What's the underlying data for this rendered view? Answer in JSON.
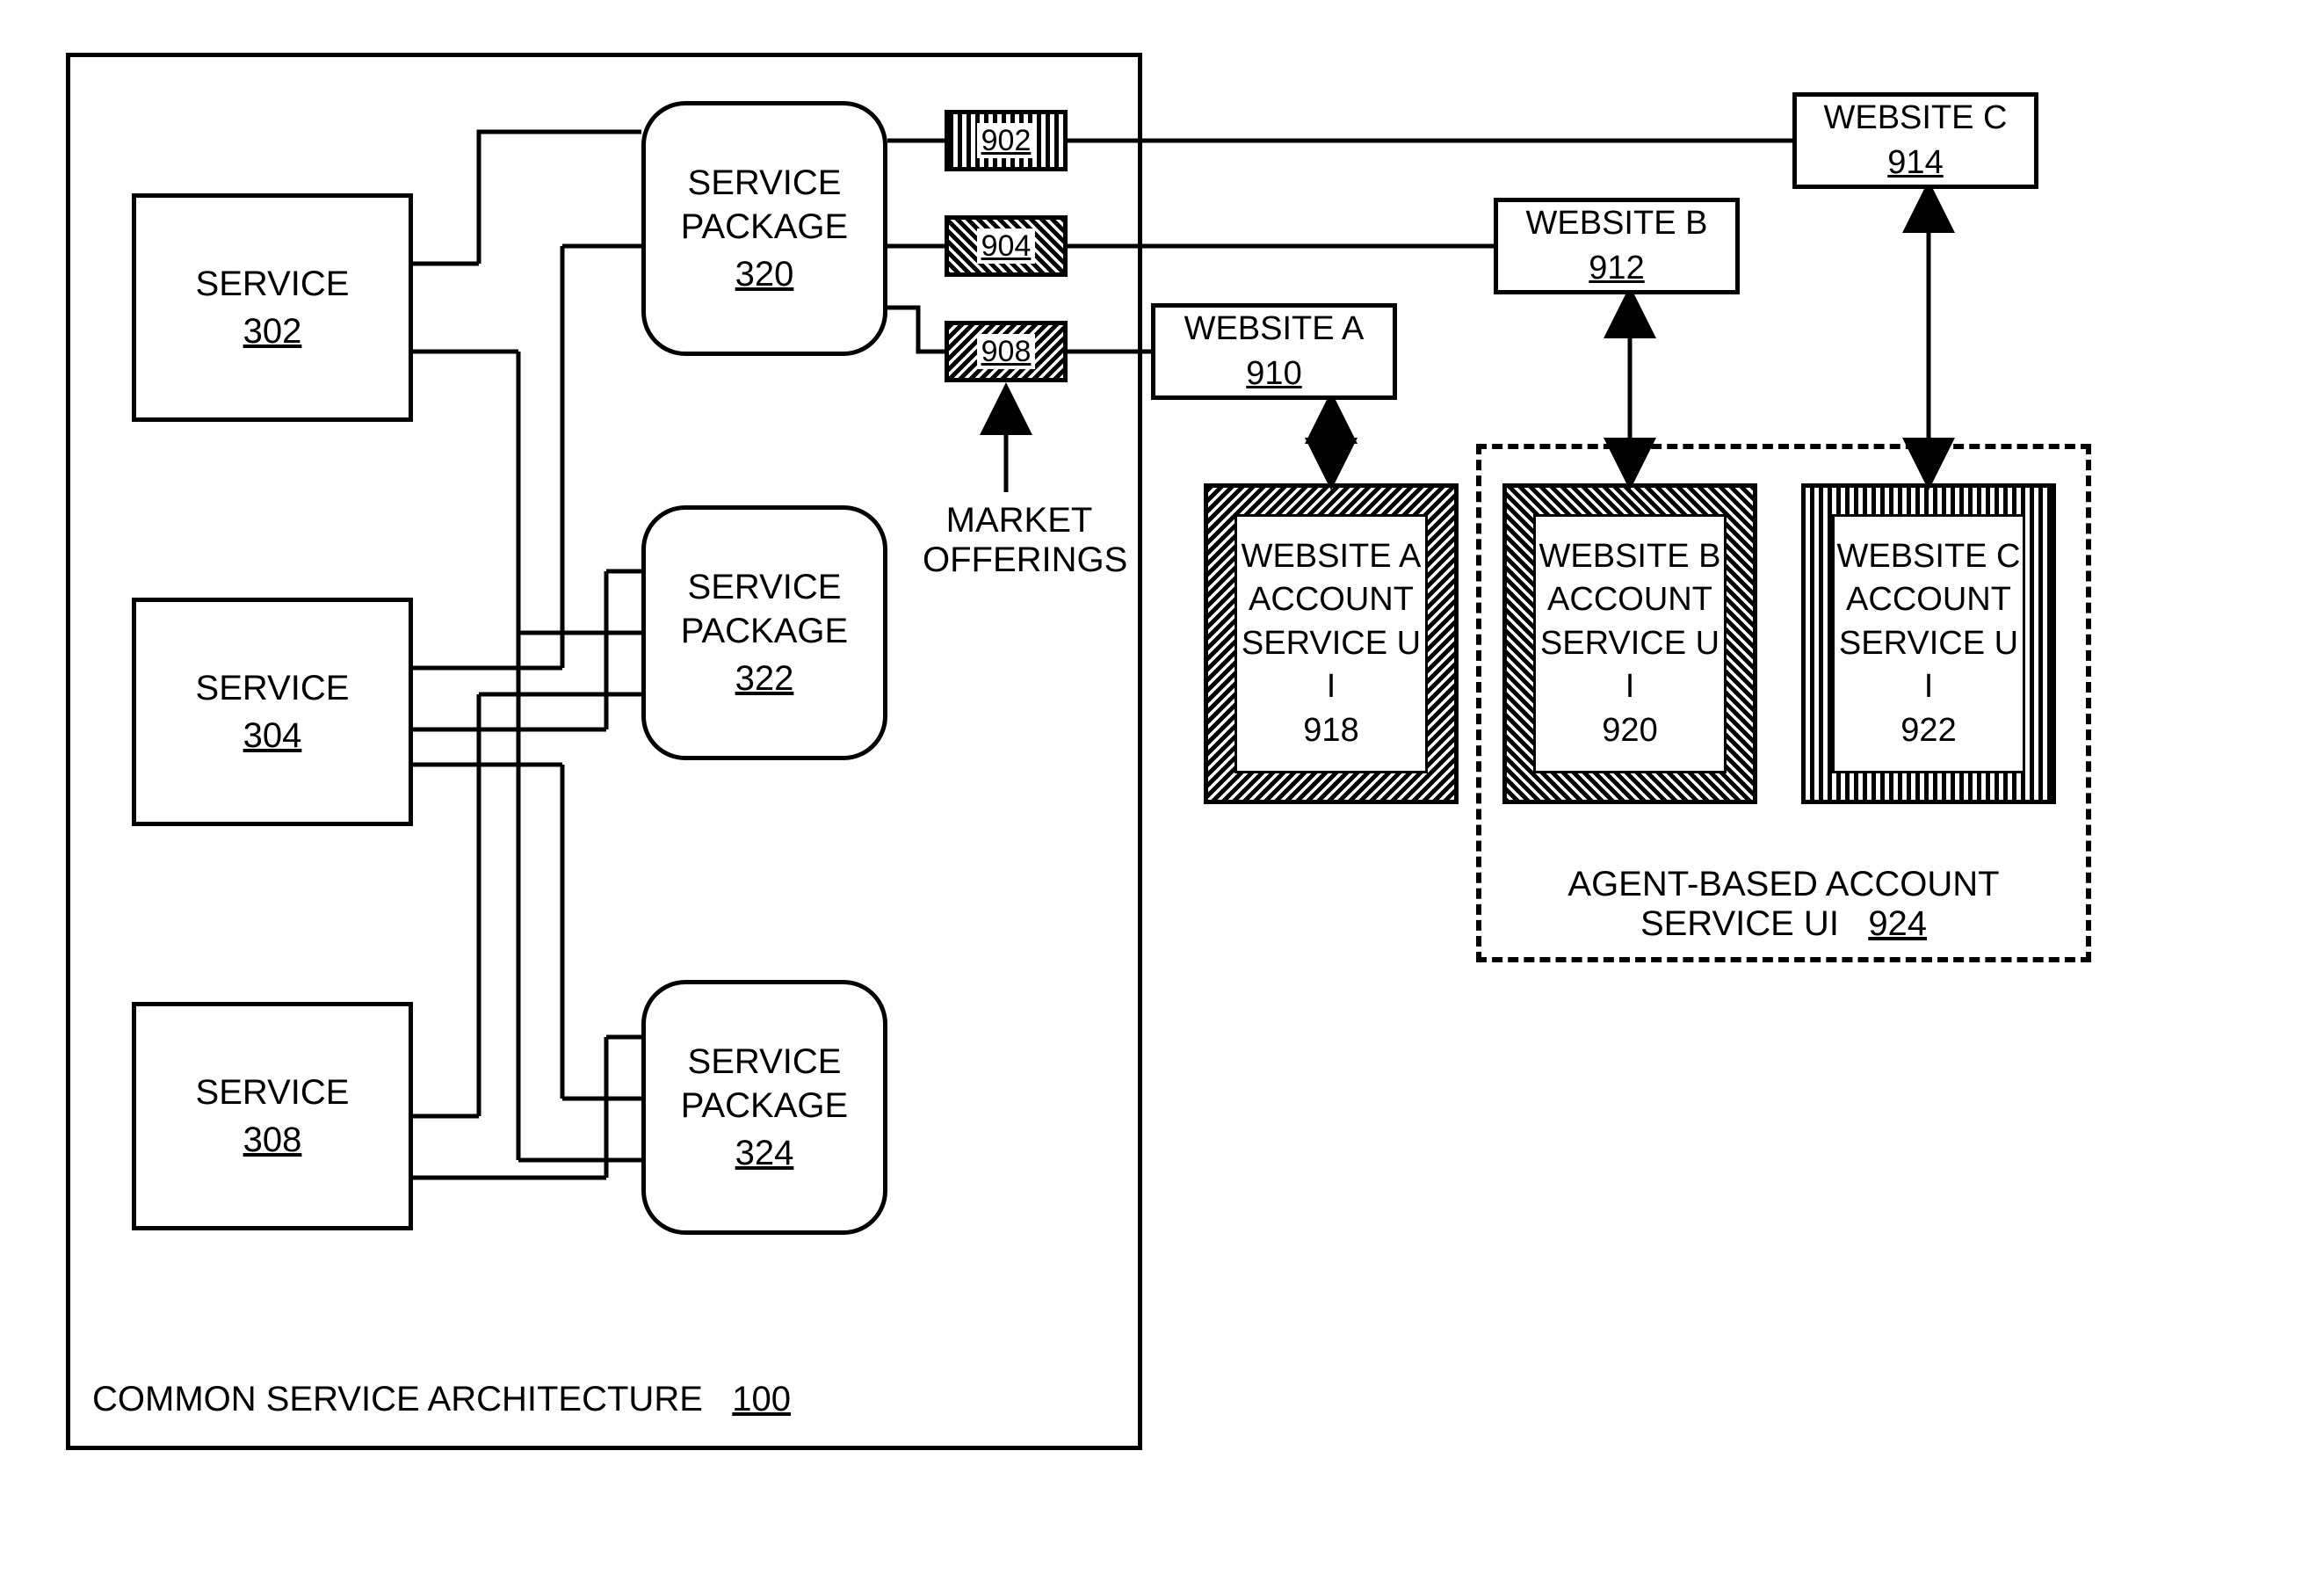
{
  "architecture": {
    "label": "COMMON SERVICE ARCHITECTURE",
    "ref": "100"
  },
  "services": [
    {
      "label": "SERVICE",
      "ref": "302"
    },
    {
      "label": "SERVICE",
      "ref": "304"
    },
    {
      "label": "SERVICE",
      "ref": "308"
    }
  ],
  "packages": [
    {
      "label1": "SERVICE",
      "label2": "PACKAGE",
      "ref": "320"
    },
    {
      "label1": "SERVICE",
      "label2": "PACKAGE",
      "ref": "322"
    },
    {
      "label1": "SERVICE",
      "label2": "PACKAGE",
      "ref": "324"
    }
  ],
  "offerings": [
    {
      "ref": "902"
    },
    {
      "ref": "904"
    },
    {
      "ref": "908"
    }
  ],
  "offerings_label": {
    "l1": "MARKET",
    "l2": "OFFERINGS"
  },
  "websites": [
    {
      "label": "WEBSITE A",
      "ref": "910"
    },
    {
      "label": "WEBSITE B",
      "ref": "912"
    },
    {
      "label": "WEBSITE C",
      "ref": "914"
    }
  ],
  "uis": [
    {
      "l1": "WEBSITE A",
      "l2": "ACCOUNT",
      "l3": "SERVICE U I",
      "ref": "918"
    },
    {
      "l1": "WEBSITE B",
      "l2": "ACCOUNT",
      "l3": "SERVICE U I",
      "ref": "920"
    },
    {
      "l1": "WEBSITE C",
      "l2": "ACCOUNT",
      "l3": "SERVICE U I",
      "ref": "922"
    }
  ],
  "agent_box": {
    "l1": "AGENT-BASED ACCOUNT",
    "l2": "SERVICE UI",
    "ref": "924"
  }
}
